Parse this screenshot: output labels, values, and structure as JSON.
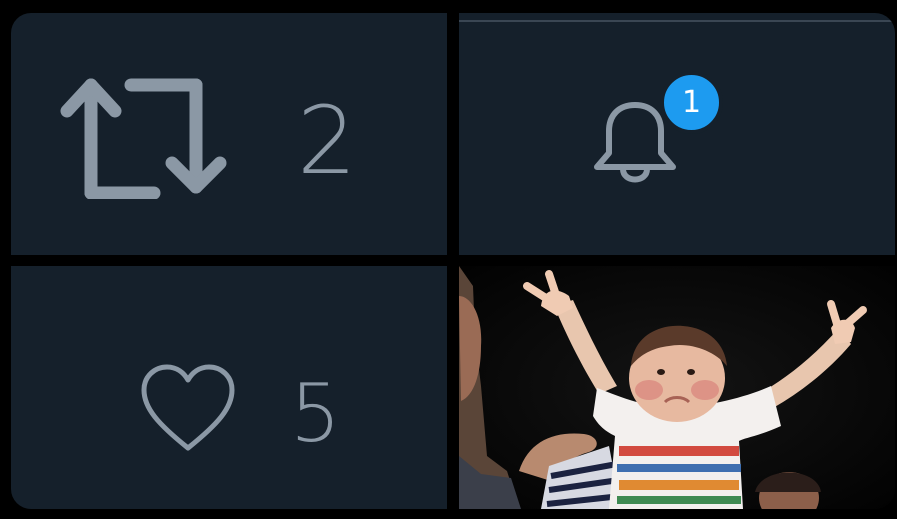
{
  "retweet": {
    "icon": "retweet-icon",
    "count": "2"
  },
  "notifications": {
    "icon": "bell-icon",
    "badge_count": "1"
  },
  "like": {
    "icon": "heart-icon",
    "count": "5"
  },
  "photo": {
    "description": ""
  },
  "colors": {
    "background": "#000000",
    "panel": "#15202b",
    "icon_gray": "#8b98a5",
    "badge_blue": "#1d9bf0"
  }
}
